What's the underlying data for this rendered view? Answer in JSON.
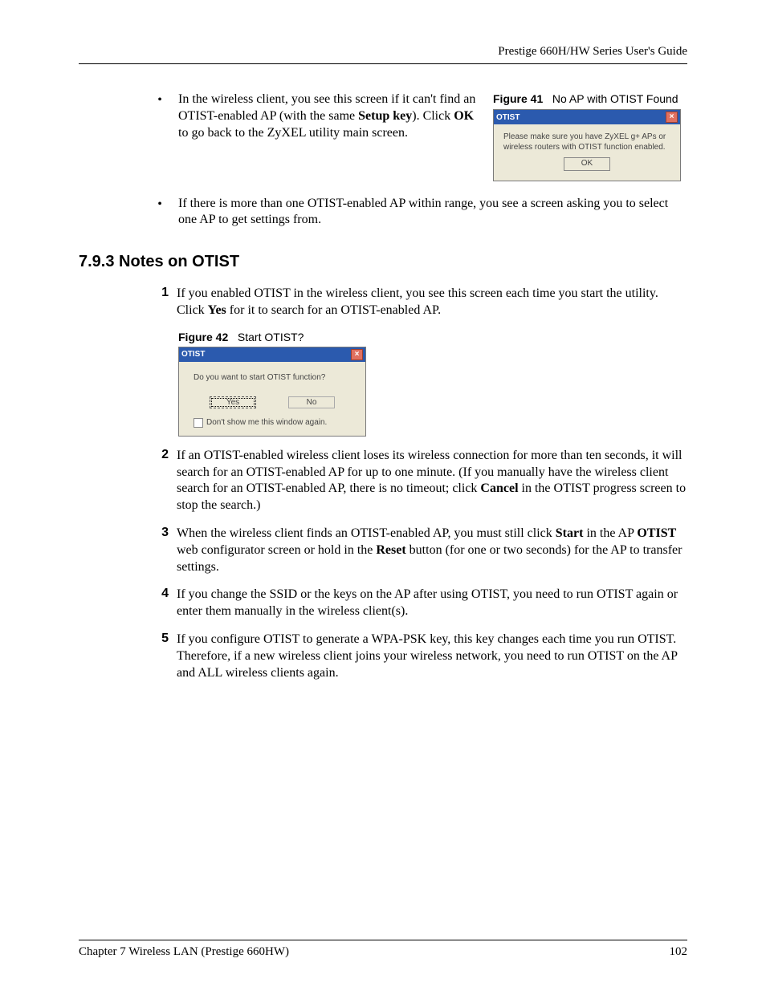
{
  "header": {
    "guide_title": "Prestige 660H/HW Series User's Guide"
  },
  "bullet1": {
    "pre": "In the wireless client, you see this screen if it can't find an OTIST-enabled AP (with the same ",
    "bold1": "Setup key",
    "mid": "). Click ",
    "bold2": "OK",
    "post": " to go back to the ZyXEL utility main screen."
  },
  "figure41": {
    "label": "Figure 41",
    "caption": "No AP with OTIST Found",
    "dialog_title": "OTIST",
    "message": "Please make sure you have ZyXEL g+ APs or wireless routers with OTIST function enabled.",
    "ok": "OK"
  },
  "bullet2": "If there is more than one OTIST-enabled AP within range, you see a screen asking you to select one AP to get settings from.",
  "heading": "7.9.3  Notes on OTIST",
  "item1": {
    "pre": "If you enabled OTIST in the wireless client, you see this screen each time you start the utility. Click ",
    "bold": "Yes",
    "post": " for it to search for an OTIST-enabled AP."
  },
  "figure42": {
    "label": "Figure 42",
    "caption": "Start OTIST?",
    "dialog_title": "OTIST",
    "question": "Do you want to start OTIST function?",
    "yes": "Yes",
    "no": "No",
    "checkbox": "Don't show me this window again."
  },
  "item2": {
    "pre": "If an OTIST-enabled wireless client loses its wireless connection for more than ten seconds, it will search for an OTIST-enabled AP for up to one minute. (If you manually have the wireless client search for an OTIST-enabled AP, there is no timeout; click ",
    "bold": "Cancel",
    "post": " in the OTIST progress screen to stop the search.)"
  },
  "item3": {
    "pre": "When the wireless client finds an OTIST-enabled AP, you must still click ",
    "b1": "Start",
    "mid1": " in the AP ",
    "b2": "OTIST",
    "mid2": " web configurator screen or hold in the ",
    "b3": "Reset",
    "post": " button (for one or two seconds) for the AP to transfer settings."
  },
  "item4": "If you change the SSID or the keys on the AP after using OTIST, you need to run OTIST again or enter them manually in the wireless client(s).",
  "item5": "If you configure OTIST to generate a WPA-PSK key, this key changes each time you run OTIST. Therefore, if a new wireless client joins your wireless network, you need to run OTIST on the AP and ALL wireless clients again.",
  "footer": {
    "chapter": "Chapter 7 Wireless LAN (Prestige 660HW)",
    "page": "102"
  },
  "numbers": {
    "n1": "1",
    "n2": "2",
    "n3": "3",
    "n4": "4",
    "n5": "5"
  }
}
